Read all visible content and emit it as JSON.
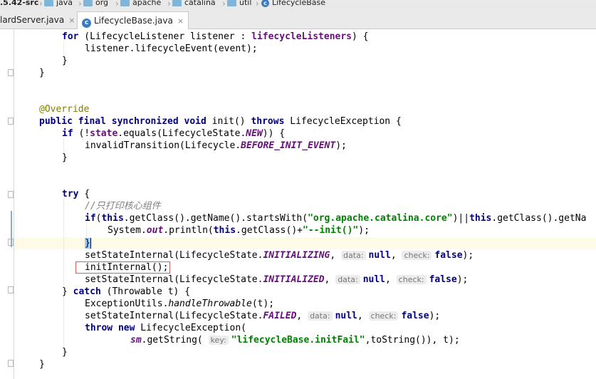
{
  "breadcrumb": {
    "items": [
      {
        "label": ".5.42-src",
        "icon": "none"
      },
      {
        "label": "java",
        "icon": "folder-icon"
      },
      {
        "label": "org",
        "icon": "folder-icon"
      },
      {
        "label": "apache",
        "icon": "folder-icon"
      },
      {
        "label": "catalina",
        "icon": "folder-icon"
      },
      {
        "label": "util",
        "icon": "folder-icon"
      },
      {
        "label": "LifecycleBase",
        "icon": "class-icon"
      }
    ]
  },
  "tabs": [
    {
      "label": "lardServer.java",
      "close": "×",
      "active": false
    },
    {
      "label": "LifecycleBase.java",
      "close": "×",
      "active": true
    }
  ],
  "code": {
    "l1": {
      "a": "for",
      "b": " (LifecycleListener listener : ",
      "c": "lifecycleListeners",
      "d": ") {"
    },
    "l2": "listener.lifecycleEvent(event);",
    "l3": "}",
    "l4": "}",
    "l5": "@Override",
    "l6": {
      "a": "public",
      "b": "final",
      "c": "synchronized",
      "d": "void",
      "e": " init() ",
      "f": "throws",
      "g": " LifecycleException {"
    },
    "l7": {
      "a": "if",
      "b": " (!",
      "c": "state",
      "d": ".equals(LifecycleState.",
      "e": "NEW",
      "f": ")) {"
    },
    "l8": {
      "a": "invalidTransition(Lifecycle.",
      "b": "BEFORE_INIT_EVENT",
      "c": ");"
    },
    "l9": "}",
    "l10": {
      "a": "try",
      "b": " {"
    },
    "l11": "//只打印核心组件",
    "l12": {
      "a": "if",
      "b": "(",
      "c": "this",
      "d": ".getClass().getName().startsWith(",
      "e": "\"org.apache.catalina.core\"",
      "f": ")||",
      "g": "this",
      "h": ".getClass().getNa"
    },
    "l13": {
      "a": "System.",
      "b": "out",
      "c": ".println(",
      "d": "this",
      "e": ".getClass()+",
      "f": "\"--init()\"",
      "g": ");"
    },
    "l14": "}",
    "l15": {
      "a": "setStateInternal(LifecycleState.",
      "b": "INITIALIZING",
      "c": ", ",
      "h1": "data:",
      "d": "null",
      "e": ", ",
      "h2": "check:",
      "f": "false",
      "g": ");"
    },
    "l16": "initInternal();",
    "l17": {
      "a": "setStateInternal(LifecycleState.",
      "b": "INITIALIZED",
      "c": ", ",
      "h1": "data:",
      "d": "null",
      "e": ", ",
      "h2": "check:",
      "f": "false",
      "g": ");"
    },
    "l18": {
      "a": "} ",
      "b": "catch",
      "c": " (Throwable t) {"
    },
    "l19": {
      "a": "ExceptionUtils.",
      "b": "handleThrowable",
      "c": "(t);"
    },
    "l20": {
      "a": "setStateInternal(LifecycleState.",
      "b": "FAILED",
      "c": ", ",
      "h1": "data:",
      "d": "null",
      "e": ", ",
      "h2": "check:",
      "f": "false",
      "g": ");"
    },
    "l21": {
      "a": "throw",
      "b": "new",
      "c": " LifecycleException("
    },
    "l22": {
      "a": "sm",
      "b": ".getString( ",
      "h1": "key:",
      "c": "\"lifecycleBase.initFail\"",
      "d": ",toString()), t);"
    },
    "l23": "}",
    "l24": "}"
  }
}
